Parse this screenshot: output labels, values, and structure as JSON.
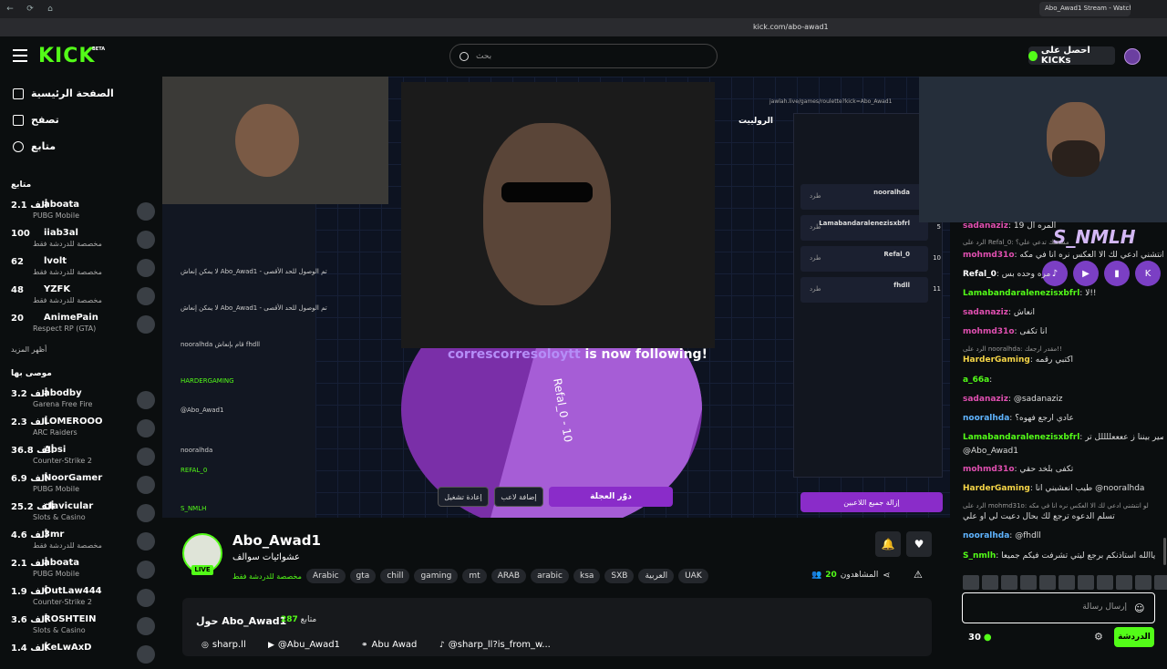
{
  "browser": {
    "tab_title": "Abo_Awad1 Stream - Watch",
    "url": "kick.com/abo-awad1"
  },
  "header": {
    "logo": "KICK",
    "logo_badge": "BETA",
    "search_placeholder": "بحث",
    "kicks_label": "احصل على KICKs"
  },
  "sidebar": {
    "nav": [
      {
        "label": "الصفحة الرئيسية",
        "icon": "home-icon"
      },
      {
        "label": "تصفح",
        "icon": "browse-icon"
      },
      {
        "label": "متابع",
        "icon": "heart-icon"
      }
    ],
    "following_title": "متابع",
    "following": [
      {
        "count": "2.1 ألف",
        "name": "aboata",
        "category": "PUBG Mobile"
      },
      {
        "count": "100",
        "name": "iiab3al",
        "category": "مخصصة للدردشة فقط"
      },
      {
        "count": "62",
        "name": "lvolt",
        "category": "مخصصة للدردشة فقط"
      },
      {
        "count": "48",
        "name": "YZFK",
        "category": "مخصصة للدردشة فقط"
      },
      {
        "count": "20",
        "name": "AnimePain",
        "category": "Respect RP (GTA)"
      }
    ],
    "show_more": "أظهر المزيد",
    "recommended_title": "موصى بها",
    "recommended": [
      {
        "count": "3.2 ألف",
        "name": "abodby",
        "category": "Garena Free Fire"
      },
      {
        "count": "2.3 ألف",
        "name": "LOMEROOO",
        "category": "ARC Raiders"
      },
      {
        "count": "36.8 ألف",
        "name": "Absi",
        "category": "Counter-Strike 2"
      },
      {
        "count": "6.9 ألف",
        "name": "NoorGamer",
        "category": "PUBG Mobile"
      },
      {
        "count": "25.2 ألف",
        "name": "clavicular",
        "category": "Slots & Casino"
      },
      {
        "count": "4.6 ألف",
        "name": "3mr",
        "category": "مخصصة للدردشة فقط"
      },
      {
        "count": "2.1 ألف",
        "name": "aboata",
        "category": "PUBG Mobile"
      },
      {
        "count": "1.9 ألف",
        "name": "OutLaw444",
        "category": "Counter-Strike 2"
      },
      {
        "count": "3.6 ألف",
        "name": "ROSHTEIN",
        "category": "Slots & Casino"
      },
      {
        "count": "1.4 ألف",
        "name": "KeLwAxD",
        "category": ""
      }
    ]
  },
  "video": {
    "follow_user": "correscorresoloytt",
    "follow_suffix": "is now following!",
    "wheel_label": "Refal_0 - 10",
    "spin_button": "دوّر العجلة",
    "add_player": "إضافة لاعب",
    "reset": "إعادة تشغيل",
    "remove_all": "إزالة جميع اللاعبين",
    "inner_title": "الرولييت",
    "inner_url": "jawlah.live/games/roulette?kick=Abo_Awad1",
    "players": [
      {
        "name": "nooralhda",
        "num": ""
      },
      {
        "name": "Lamabandaralenezisxbfrl",
        "num": "5"
      },
      {
        "name": "Refal_0",
        "num": "10"
      },
      {
        "name": "fhdll",
        "num": "11"
      }
    ],
    "kick_label": "طرد",
    "inner_chat": [
      "لا يمكن إنعاش Abo_Awad1 - تم الوصول للحد الأقصى",
      "لا يمكن إنعاش Abo_Awad1 - تم الوصول للحد الأقصى",
      "nooralhda قام بإنعاش fhdll",
      "HARDERGAMING",
      "@Abo_Awad1",
      "nooralhda",
      "REFAL_0",
      "S_NMLH"
    ]
  },
  "stream": {
    "streamer": "Abo_Awad1",
    "title": "عشوائيات   سوالف",
    "category": "مخصصة للدردشة فقط",
    "live": "LIVE",
    "tags": [
      "UAK",
      "العربية",
      "SXB",
      "ksa",
      "arabic",
      "ARAB",
      "mt",
      "gaming",
      "chill",
      "gta",
      "Arabic"
    ],
    "viewers_label": "المشاهدون",
    "viewers": "20",
    "about_title": "حول Abo_Awad1",
    "followers_label": "متابع",
    "followers": "287",
    "socials": [
      {
        "icon": "instagram-icon",
        "label": "sharp.ll"
      },
      {
        "icon": "youtube-icon",
        "label": "@Abu_Awad1"
      },
      {
        "icon": "link-icon",
        "label": "Abu Awad"
      },
      {
        "icon": "tiktok-icon",
        "label": "@sharp_ll?is_from_w..."
      }
    ]
  },
  "chat": {
    "overlay_name": "S_NMLH",
    "messages": [
      {
        "user": "sadanaziz",
        "color": "#e04fb0",
        "text": "المره ال 19"
      },
      {
        "user": "mohmd31o",
        "color": "#e04fb0",
        "text": "لو انتشني ادعي لك الا العكس نره انا في مكه"
      },
      {
        "user": "Refal_0",
        "color": "#ffffff",
        "text": "مره وحده بس"
      },
      {
        "user": "Lamabandaralenezisxbfrl",
        "color": "#53fc18",
        "text": "لا!!"
      },
      {
        "user": "sadanaziz",
        "color": "#e04fb0",
        "text": "انعاش"
      },
      {
        "user": "mohmd31o",
        "color": "#e04fb0",
        "text": "انا تكفى"
      },
      {
        "user": "HarderGaming",
        "color": "#f5d547",
        "text": "اكتبي رقمه"
      },
      {
        "user": "a_66a",
        "color": "#53fc18",
        "text": ""
      },
      {
        "user": "sadanaziz",
        "color": "#e04fb0",
        "text": "@sadanaziz"
      },
      {
        "user": "nooralhda",
        "color": "#5fb4ff",
        "text": "عادي ارجع فهوه؟"
      },
      {
        "user": "Lamabandaralenezisxbfrl",
        "color": "#53fc18",
        "text": "بيصير بيننا ز ععععللللل تر!!!"
      },
      {
        "user": "",
        "color": "#ffffff",
        "text": "@Abo_Awad1"
      },
      {
        "user": "mohmd31o",
        "color": "#e04fb0",
        "text": "تكفى بلخد حقي"
      },
      {
        "user": "HarderGaming",
        "color": "#f5d547",
        "text": "طيب انعشيني انا @nooralhda"
      },
      {
        "user": "",
        "color": "#ffffff",
        "text": "تسلم الدعوه ترجع لك بحال دعيت لي او علي"
      },
      {
        "user": "nooralhda",
        "color": "#5fb4ff",
        "text": "@fhdll"
      },
      {
        "user": "S_nmlh",
        "color": "#53fc18",
        "text": "ياالله استاذنكم برجع ليتي تشرفت فيكم جميعا"
      }
    ],
    "replies": [
      {
        "text": "الرد على Refal_0: مسحتك تدعي علي؟"
      },
      {
        "text": "الرد على nooralhda: مقدر ارجعك!!"
      },
      {
        "text": "الرد على mohmd31o: لو انتشني ادعي لك الا العكس نره انا في مكه"
      }
    ],
    "input_placeholder": "إرسال رسالة",
    "send_label": "الدردشة",
    "kicks_count": "30"
  },
  "colors": {
    "brand": "#53fc18",
    "purple": "#8a2cc9",
    "background": "#0b0e0f"
  }
}
